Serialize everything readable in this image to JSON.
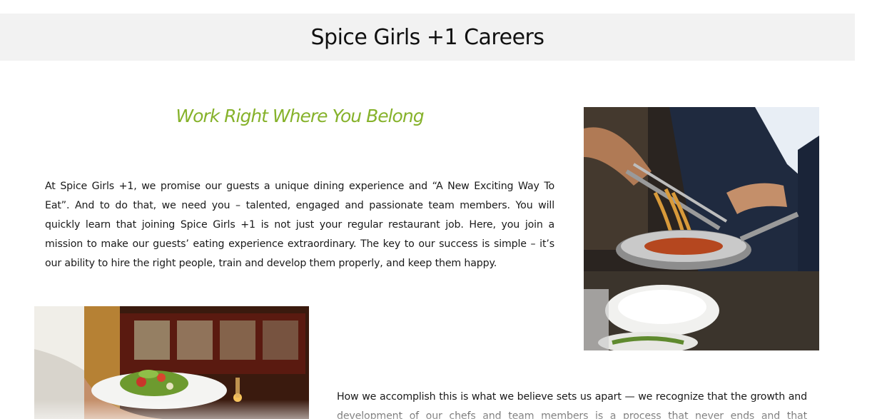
{
  "header": {
    "title": "Spice Girls +1 Careers"
  },
  "main": {
    "heading": "Work Right Where You Belong",
    "intro_paragraph": "At Spice Girls +1, we promise our guests a unique dining experience and “A New Exciting Way To Eat”. And to do that, we need you – talented, engaged and passionate team members. You will quickly learn that joining Spice Girls +1 is not just your regular restaurant job. Here, you join a mission to make our guests’ eating experience extraordinary. The key to our success is simple – it’s our ability to hire the right people, train and develop them properly, and keep them happy.",
    "second_paragraph": "How we accomplish this is what we believe sets us apart — we recognize that the growth and development of our chefs and team members is a process that never ends and that"
  },
  "images": {
    "chef_photo": "chef tossing pasta in a pan",
    "server_photo": "server holding a plated salad in a restaurant"
  },
  "colors": {
    "header_background": "#f2f2f2",
    "heading_accent": "#86b22b",
    "body_text": "#1a1a1a"
  }
}
